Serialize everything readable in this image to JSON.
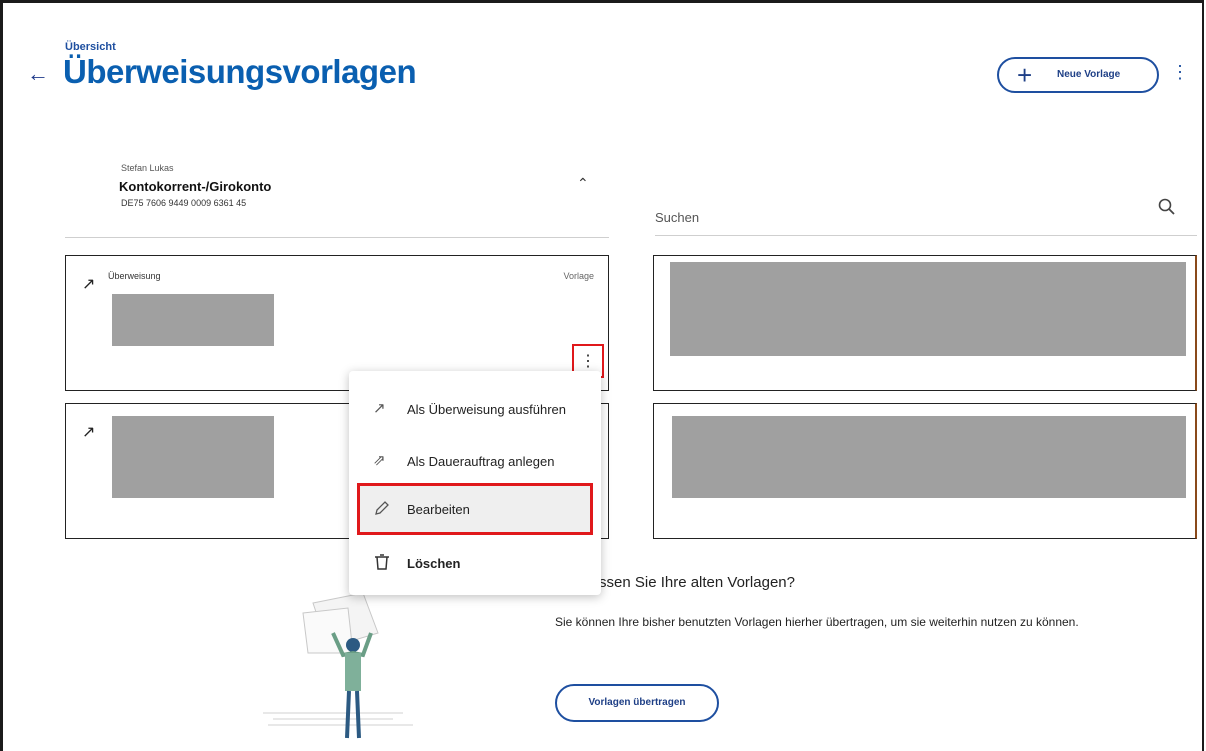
{
  "header": {
    "breadcrumb": "Übersicht",
    "title": "Überweisungsvorlagen",
    "new_button_label": "Neue Vorlage"
  },
  "account": {
    "owner": "Stefan Lukas",
    "name": "Kontokorrent-/Girokonto",
    "iban": "DE75 7606 9449 0009 6361 45"
  },
  "search": {
    "placeholder": "Suchen"
  },
  "cards": [
    {
      "type": "Überweisung",
      "tag": "Vorlage"
    }
  ],
  "context_menu": {
    "items": [
      {
        "label": "Als Überweisung ausführen",
        "icon": "arrow-up-right-icon"
      },
      {
        "label": "Als Dauerauftrag anlegen",
        "icon": "standing-order-icon"
      },
      {
        "label": "Bearbeiten",
        "icon": "pencil-icon"
      },
      {
        "label": "Löschen",
        "icon": "trash-icon"
      }
    ]
  },
  "missing_templates": {
    "title": "ssen Sie Ihre alten Vorlagen?",
    "text": "Sie können Ihre bisher benutzten Vorlagen hierher übertragen, um sie weiterhin nutzen zu können.",
    "button_label": "Vorlagen übertragen"
  },
  "colors": {
    "primary": "#1e4fa0",
    "title": "#0a5fb0",
    "highlight": "#e0181b"
  }
}
